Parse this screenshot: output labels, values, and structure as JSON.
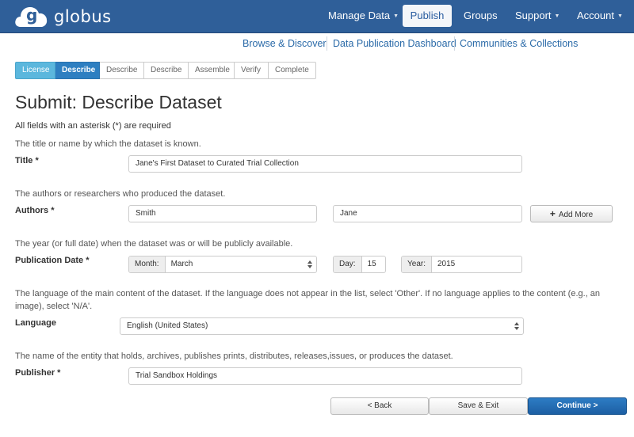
{
  "brand": {
    "name": "globus",
    "logo_letter": "g"
  },
  "nav": {
    "items": [
      {
        "label": "Manage Data",
        "has_caret": true
      },
      {
        "label": "Publish",
        "active": true
      },
      {
        "label": "Groups"
      },
      {
        "label": "Support",
        "has_caret": true
      },
      {
        "label": "Account",
        "has_caret": true
      }
    ],
    "caret": "▼"
  },
  "subnav": [
    "Browse & Discover",
    "Data Publication Dashboard",
    "Communities & Collections"
  ],
  "steps": [
    "License",
    "Describe",
    "Describe",
    "Describe",
    "Assemble",
    "Verify",
    "Complete"
  ],
  "page": {
    "title": "Submit: Describe Dataset",
    "required_note": "All fields with an asterisk (*) are required"
  },
  "form": {
    "title": {
      "help": "The title or name by which the dataset is known.",
      "label": "Title *",
      "value": "Jane's First Dataset to Curated Trial Collection"
    },
    "authors": {
      "help": "The authors or researchers who produced the dataset.",
      "label": "Authors *",
      "last": "Smith",
      "first": "Jane",
      "add_more": "Add More"
    },
    "pubdate": {
      "help": "The year (or full date) when the dataset was or will be publicly available.",
      "label": "Publication Date *",
      "month_label": "Month:",
      "month_value": "March",
      "day_label": "Day:",
      "day_value": "15",
      "year_label": "Year:",
      "year_value": "2015"
    },
    "language": {
      "help": "The language of the main content of the dataset. If the language does not appear in the list, select 'Other'. If no language applies to the content (e.g., an image), select 'N/A'.",
      "label": "Language",
      "value": "English (United States)"
    },
    "publisher": {
      "help": "The name of the entity that holds, archives, publishes prints, distributes, releases,issues, or produces the dataset.",
      "label": "Publisher *",
      "value": "Trial Sandbox Holdings"
    }
  },
  "actions": {
    "back": "< Back",
    "save": "Save & Exit",
    "continue": "Continue >"
  },
  "colors": {
    "navbar": "#2f5f99",
    "link": "#2a6aa8",
    "step_done": "#5bb7dd",
    "step_current": "#2e7fc1",
    "primary": "#1d5fa3"
  }
}
